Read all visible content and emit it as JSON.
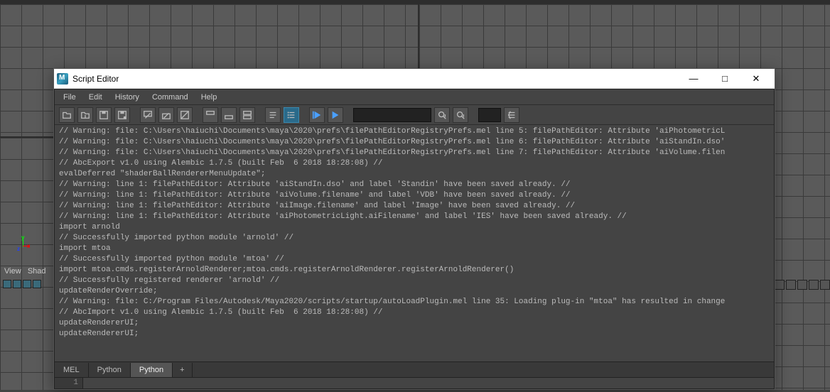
{
  "window": {
    "title": "Script Editor",
    "minimize": "—",
    "maximize": "□",
    "close": "✕"
  },
  "menu": {
    "file": "File",
    "edit": "Edit",
    "history": "History",
    "command": "Command",
    "help": "Help"
  },
  "toolbar": {
    "search_value": "",
    "goto_value": ""
  },
  "tabs": {
    "items": [
      {
        "label": "MEL",
        "active": false
      },
      {
        "label": "Python",
        "active": false
      },
      {
        "label": "Python",
        "active": true
      },
      {
        "label": "+",
        "active": false
      }
    ]
  },
  "input": {
    "line_number": "1",
    "value": ""
  },
  "viewport": {
    "panel_label_left": "View",
    "panel_label_right": "Shad"
  },
  "output_lines": [
    "// Warning: file: C:\\Users\\haiuchi\\Documents\\maya\\2020\\prefs\\filePathEditorRegistryPrefs.mel line 5: filePathEditor: Attribute 'aiPhotometricL",
    "// Warning: file: C:\\Users\\haiuchi\\Documents\\maya\\2020\\prefs\\filePathEditorRegistryPrefs.mel line 6: filePathEditor: Attribute 'aiStandIn.dso'",
    "// Warning: file: C:\\Users\\haiuchi\\Documents\\maya\\2020\\prefs\\filePathEditorRegistryPrefs.mel line 7: filePathEditor: Attribute 'aiVolume.filen",
    "// AbcExport v1.0 using Alembic 1.7.5 (built Feb  6 2018 18:28:08) //",
    "evalDeferred \"shaderBallRendererMenuUpdate\";",
    "// Warning: line 1: filePathEditor: Attribute 'aiStandIn.dso' and label 'Standin' have been saved already. //",
    "// Warning: line 1: filePathEditor: Attribute 'aiVolume.filename' and label 'VDB' have been saved already. //",
    "// Warning: line 1: filePathEditor: Attribute 'aiImage.filename' and label 'Image' have been saved already. //",
    "// Warning: line 1: filePathEditor: Attribute 'aiPhotometricLight.aiFilename' and label 'IES' have been saved already. //",
    "import arnold",
    "// Successfully imported python module 'arnold' //",
    "import mtoa",
    "// Successfully imported python module 'mtoa' //",
    "import mtoa.cmds.registerArnoldRenderer;mtoa.cmds.registerArnoldRenderer.registerArnoldRenderer()",
    "// Successfully registered renderer 'arnold' //",
    "updateRenderOverride;",
    "// Warning: file: C:/Program Files/Autodesk/Maya2020/scripts/startup/autoLoadPlugin.mel line 35: Loading plug-in \"mtoa\" has resulted in change",
    "// AbcImport v1.0 using Alembic 1.7.5 (built Feb  6 2018 18:28:08) //",
    "updateRendererUI;",
    "updateRendererUI;"
  ]
}
